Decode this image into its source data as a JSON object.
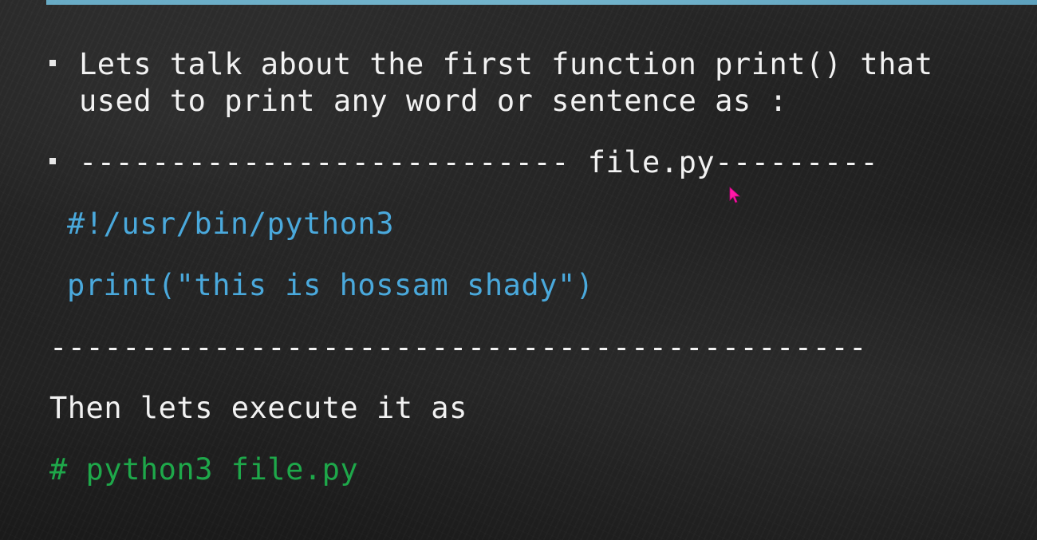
{
  "slide": {
    "bullet1_line1": "Lets talk about the first function print() that",
    "bullet1_line2": "used to print any word or sentence as :",
    "bullet2_dashes_left": "---------------------------",
    "bullet2_filename": "file.py",
    "bullet2_dashes_right": "---------",
    "code_shebang": "#!/usr/bin/python3",
    "code_print": "print(\"this is hossam shady\")",
    "separator": "---------------------------------------------",
    "then_text": "Then lets execute it as",
    "command": "# python3 file.py"
  },
  "colors": {
    "accent_top_rule": "#6fb9d6",
    "code_blue": "#4aa9dc",
    "command_green": "#1ea84a",
    "cursor_magenta": "#ff1aa6"
  },
  "icons": {
    "cursor": "mouse-pointer-icon",
    "bullet": "square-bullet-icon"
  }
}
